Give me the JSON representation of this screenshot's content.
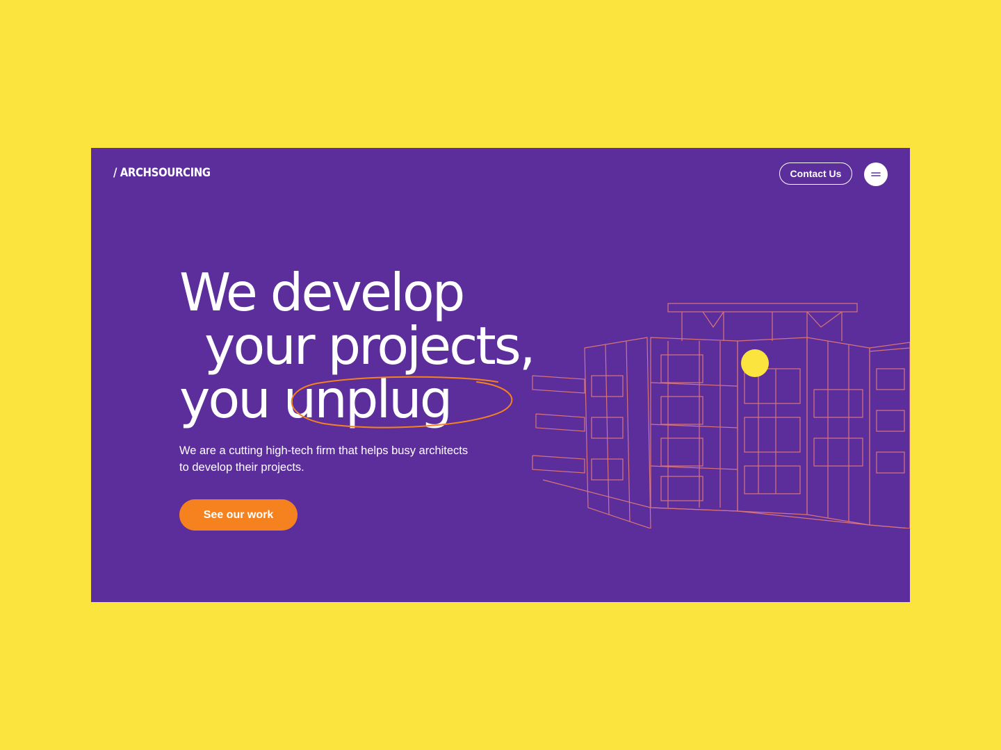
{
  "header": {
    "logo": "/ ARCHSOURCING",
    "contact_label": "Contact Us"
  },
  "hero": {
    "headline_line1": "We develop",
    "headline_line2": "your projects,",
    "headline_line3_a": "you",
    "headline_line3_b": "unplug",
    "description": "We are a cutting high-tech firm that helps busy architects to develop their projects.",
    "cta_label": "See our work"
  },
  "icons": {
    "menu": "hamburger-menu-icon",
    "illustration": "building-wireframe-illustration"
  },
  "colors": {
    "page_background": "#fbe43d",
    "panel_background": "#5c2e9c",
    "accent_orange": "#f6821f",
    "wireframe": "#d8747a",
    "dot_yellow": "#fbe43d",
    "text": "#ffffff"
  }
}
